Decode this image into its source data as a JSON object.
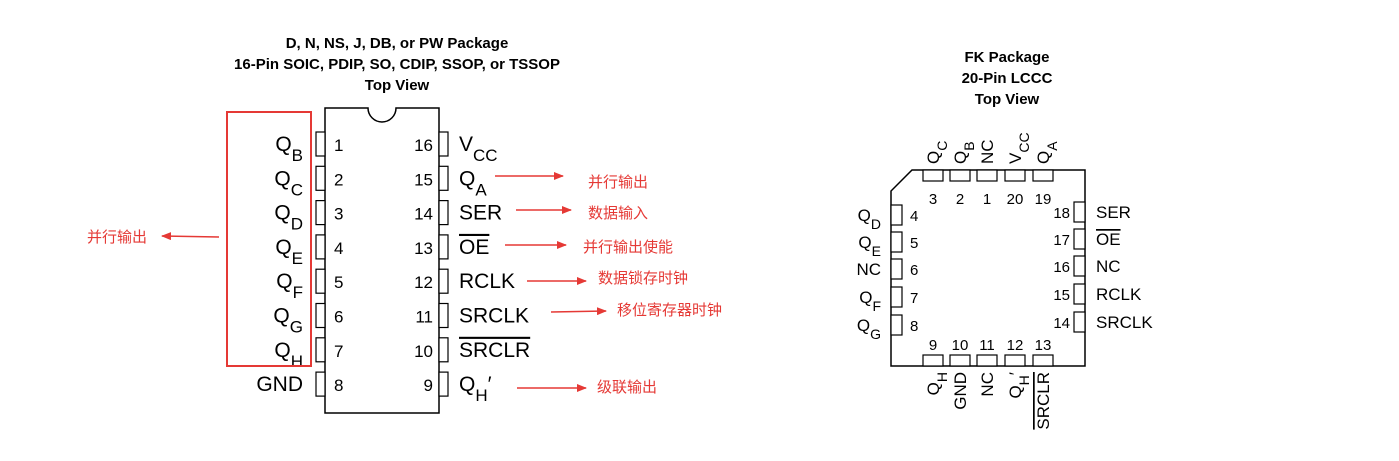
{
  "dip": {
    "title_lines": [
      "D, N, NS, J, DB, or PW Package",
      "16-Pin SOIC, PDIP, SO, CDIP, SSOP, or TSSOP",
      "Top View"
    ],
    "left_pins": [
      {
        "num": "1",
        "base": "Q",
        "sub": "B",
        "prime": "",
        "overline": false
      },
      {
        "num": "2",
        "base": "Q",
        "sub": "C",
        "prime": "",
        "overline": false
      },
      {
        "num": "3",
        "base": "Q",
        "sub": "D",
        "prime": "",
        "overline": false
      },
      {
        "num": "4",
        "base": "Q",
        "sub": "E",
        "prime": "",
        "overline": false
      },
      {
        "num": "5",
        "base": "Q",
        "sub": "F",
        "prime": "",
        "overline": false
      },
      {
        "num": "6",
        "base": "Q",
        "sub": "G",
        "prime": "",
        "overline": false
      },
      {
        "num": "7",
        "base": "Q",
        "sub": "H",
        "prime": "",
        "overline": false
      },
      {
        "num": "8",
        "base": "GND",
        "sub": "",
        "prime": "",
        "overline": false
      }
    ],
    "right_pins": [
      {
        "num": "16",
        "base": "V",
        "sub": "CC",
        "prime": "",
        "overline": false
      },
      {
        "num": "15",
        "base": "Q",
        "sub": "A",
        "prime": "",
        "overline": false
      },
      {
        "num": "14",
        "base": "SER",
        "sub": "",
        "prime": "",
        "overline": false
      },
      {
        "num": "13",
        "base": "OE",
        "sub": "",
        "prime": "",
        "overline": true
      },
      {
        "num": "12",
        "base": "RCLK",
        "sub": "",
        "prime": "",
        "overline": false
      },
      {
        "num": "11",
        "base": "SRCLK",
        "sub": "",
        "prime": "",
        "overline": false
      },
      {
        "num": "10",
        "base": "SRCLR",
        "sub": "",
        "prime": "",
        "overline": true
      },
      {
        "num": "9",
        "base": "Q",
        "sub": "H",
        "prime": "′",
        "overline": false
      }
    ]
  },
  "annotations": {
    "qa_output": "并行输出",
    "ser_input": "数据输入",
    "oe_enable": "并行输出使能",
    "rclk_clock": "数据锁存时钟",
    "srclk_clock": "移位寄存器时钟",
    "qh_cascade": "级联输出",
    "left_parallel": "并行输出"
  },
  "colors": {
    "annotation": "#e53935",
    "line": "#000000"
  },
  "fk": {
    "title_lines": [
      "FK Package",
      "20-Pin LCCC",
      "Top View"
    ],
    "top_pins": [
      {
        "num": "3",
        "base": "Q",
        "sub": "C",
        "overline": false
      },
      {
        "num": "2",
        "base": "Q",
        "sub": "B",
        "overline": false
      },
      {
        "num": "1",
        "base": "NC",
        "sub": "",
        "overline": false
      },
      {
        "num": "20",
        "base": "V",
        "sub": "CC",
        "overline": false
      },
      {
        "num": "19",
        "base": "Q",
        "sub": "A",
        "overline": false
      }
    ],
    "left_pins": [
      {
        "num": "4",
        "base": "Q",
        "sub": "D",
        "overline": false
      },
      {
        "num": "5",
        "base": "Q",
        "sub": "E",
        "overline": false
      },
      {
        "num": "6",
        "base": "NC",
        "sub": "",
        "overline": false
      },
      {
        "num": "7",
        "base": "Q",
        "sub": "F",
        "overline": false
      },
      {
        "num": "8",
        "base": "Q",
        "sub": "G",
        "overline": false
      }
    ],
    "right_pins": [
      {
        "num": "18",
        "base": "SER",
        "sub": "",
        "overline": false
      },
      {
        "num": "17",
        "base": "OE",
        "sub": "",
        "overline": true
      },
      {
        "num": "16",
        "base": "NC",
        "sub": "",
        "overline": false
      },
      {
        "num": "15",
        "base": "RCLK",
        "sub": "",
        "overline": false
      },
      {
        "num": "14",
        "base": "SRCLK",
        "sub": "",
        "overline": false
      }
    ],
    "bottom_pins": [
      {
        "num": "9",
        "base": "Q",
        "sub": "H",
        "prime": "",
        "overline": false
      },
      {
        "num": "10",
        "base": "GND",
        "sub": "",
        "prime": "",
        "overline": false
      },
      {
        "num": "11",
        "base": "NC",
        "sub": "",
        "prime": "",
        "overline": false
      },
      {
        "num": "12",
        "base": "Q",
        "sub": "H",
        "prime": "′",
        "overline": false
      },
      {
        "num": "13",
        "base": "SRCLR",
        "sub": "",
        "prime": "",
        "overline": true
      }
    ]
  }
}
